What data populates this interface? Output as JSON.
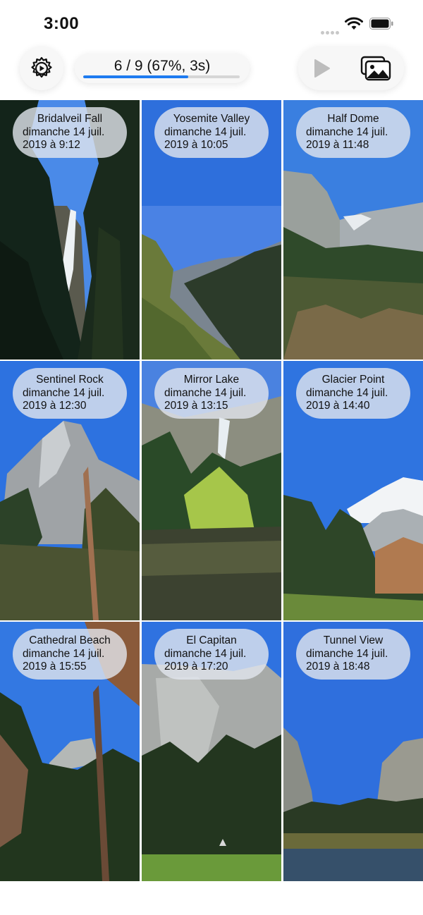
{
  "status_bar": {
    "time": "3:00"
  },
  "toolbar": {
    "progress_text": "6 / 9 (67%, 3s)",
    "progress_fraction": 0.67
  },
  "photos": [
    {
      "name": "Bridalveil Fall",
      "date": "dimanche 14 juil.\n2019 à 9:12"
    },
    {
      "name": "Yosemite Valley",
      "date": "dimanche 14 juil.\n2019 à 10:05"
    },
    {
      "name": "Half Dome",
      "date": "dimanche 14 juil.\n2019 à 11:48"
    },
    {
      "name": "Sentinel Rock",
      "date": "dimanche 14 juil.\n2019 à 12:30"
    },
    {
      "name": "Mirror Lake",
      "date": "dimanche 14 juil.\n2019 à 13:15"
    },
    {
      "name": "Glacier Point",
      "date": "dimanche 14 juil.\n2019 à 14:40"
    },
    {
      "name": "Cathedral Beach",
      "date": "dimanche 14 juil.\n2019 à 15:55"
    },
    {
      "name": "El Capitan",
      "date": "dimanche 14 juil.\n2019 à 17:20"
    },
    {
      "name": "Tunnel View",
      "date": "dimanche 14 juil.\n2019 à 18:48"
    }
  ],
  "colors": {
    "accent": "#1e7bf0",
    "label_bg": "#e2e6ee",
    "sky": "#3b7fe6"
  },
  "icons": [
    "gear-icon",
    "play-icon",
    "photo-library-icon",
    "wifi-icon",
    "battery-icon"
  ]
}
